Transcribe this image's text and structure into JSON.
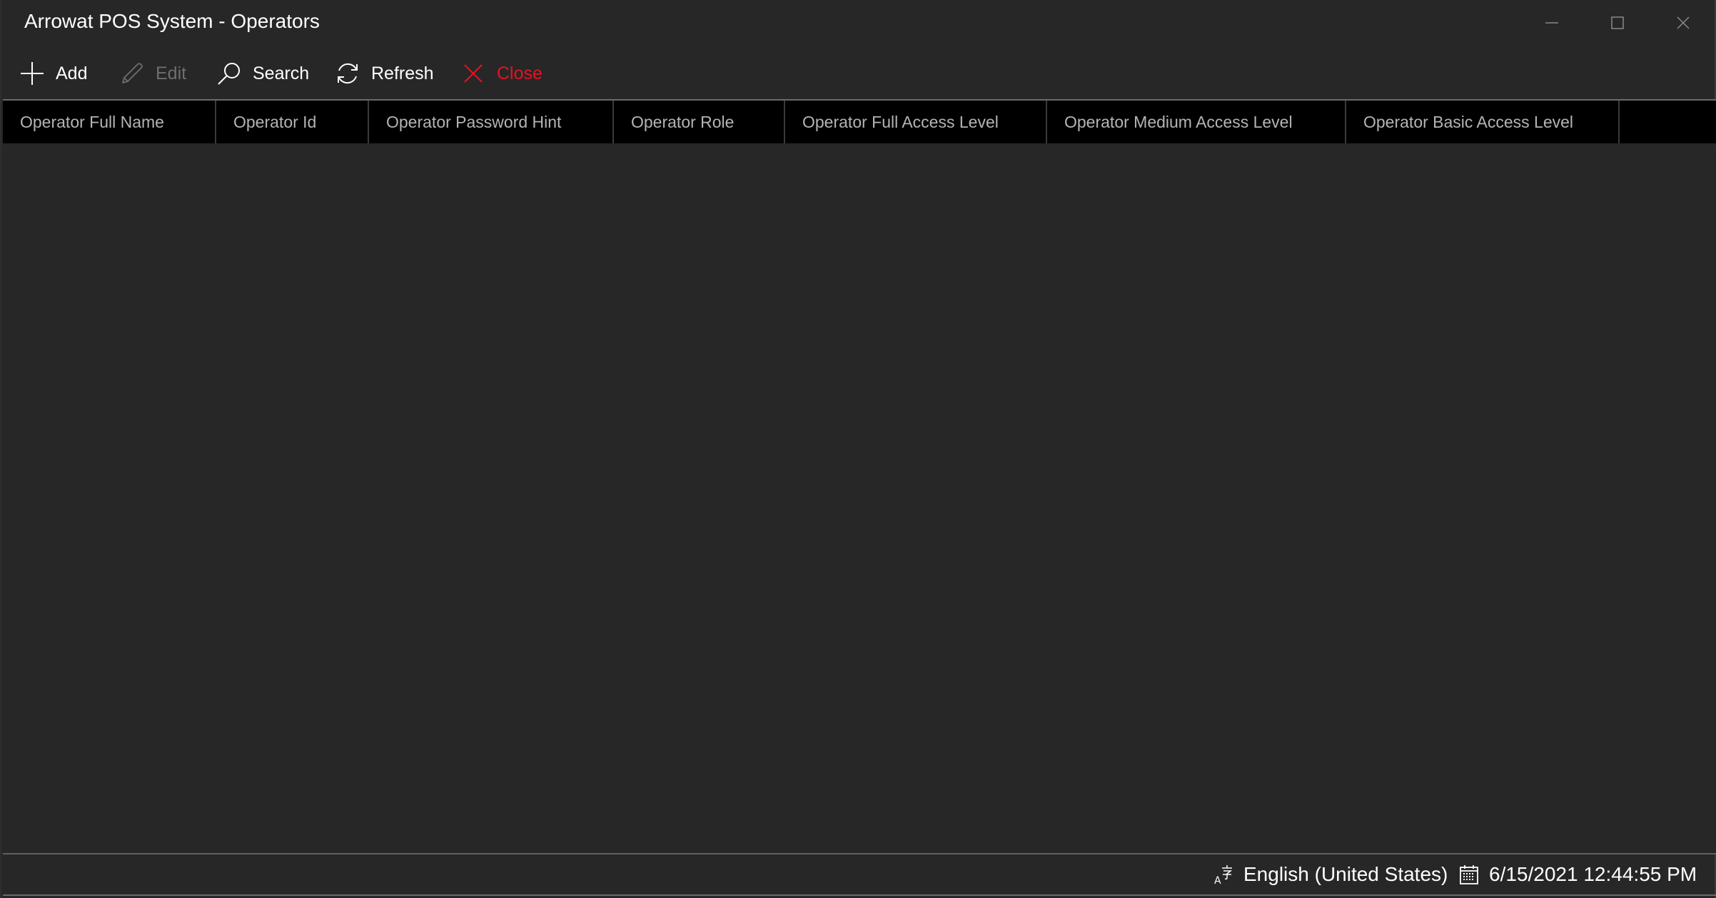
{
  "window": {
    "title": "Arrowat POS System - Operators",
    "controls": {
      "minimize": "minimize-icon",
      "maximize": "maximize-icon",
      "close": "close-icon"
    }
  },
  "toolbar": {
    "add": {
      "label": "Add",
      "icon": "plus-icon",
      "enabled": true
    },
    "edit": {
      "label": "Edit",
      "icon": "pencil-icon",
      "enabled": false
    },
    "search": {
      "label": "Search",
      "icon": "search-icon",
      "enabled": true
    },
    "refresh": {
      "label": "Refresh",
      "icon": "refresh-icon",
      "enabled": true
    },
    "close": {
      "label": "Close",
      "icon": "close-x-icon",
      "enabled": true,
      "color": "#e81123"
    }
  },
  "grid": {
    "columns": [
      "Operator Full Name",
      "Operator Id",
      "Operator Password Hint",
      "Operator Role",
      "Operator Full Access Level",
      "Operator Medium Access Level",
      "Operator Basic Access Level",
      ""
    ],
    "rows": []
  },
  "status": {
    "language": {
      "icon": "language-icon",
      "text": "English (United States)"
    },
    "datetime": {
      "icon": "calendar-icon",
      "text": "6/15/2021 12:44:55 PM"
    }
  },
  "colors": {
    "background": "#272727",
    "header_background": "#000000",
    "header_text": "#b4b4b4",
    "disabled_text": "#6e6e6e",
    "danger": "#e81123"
  }
}
